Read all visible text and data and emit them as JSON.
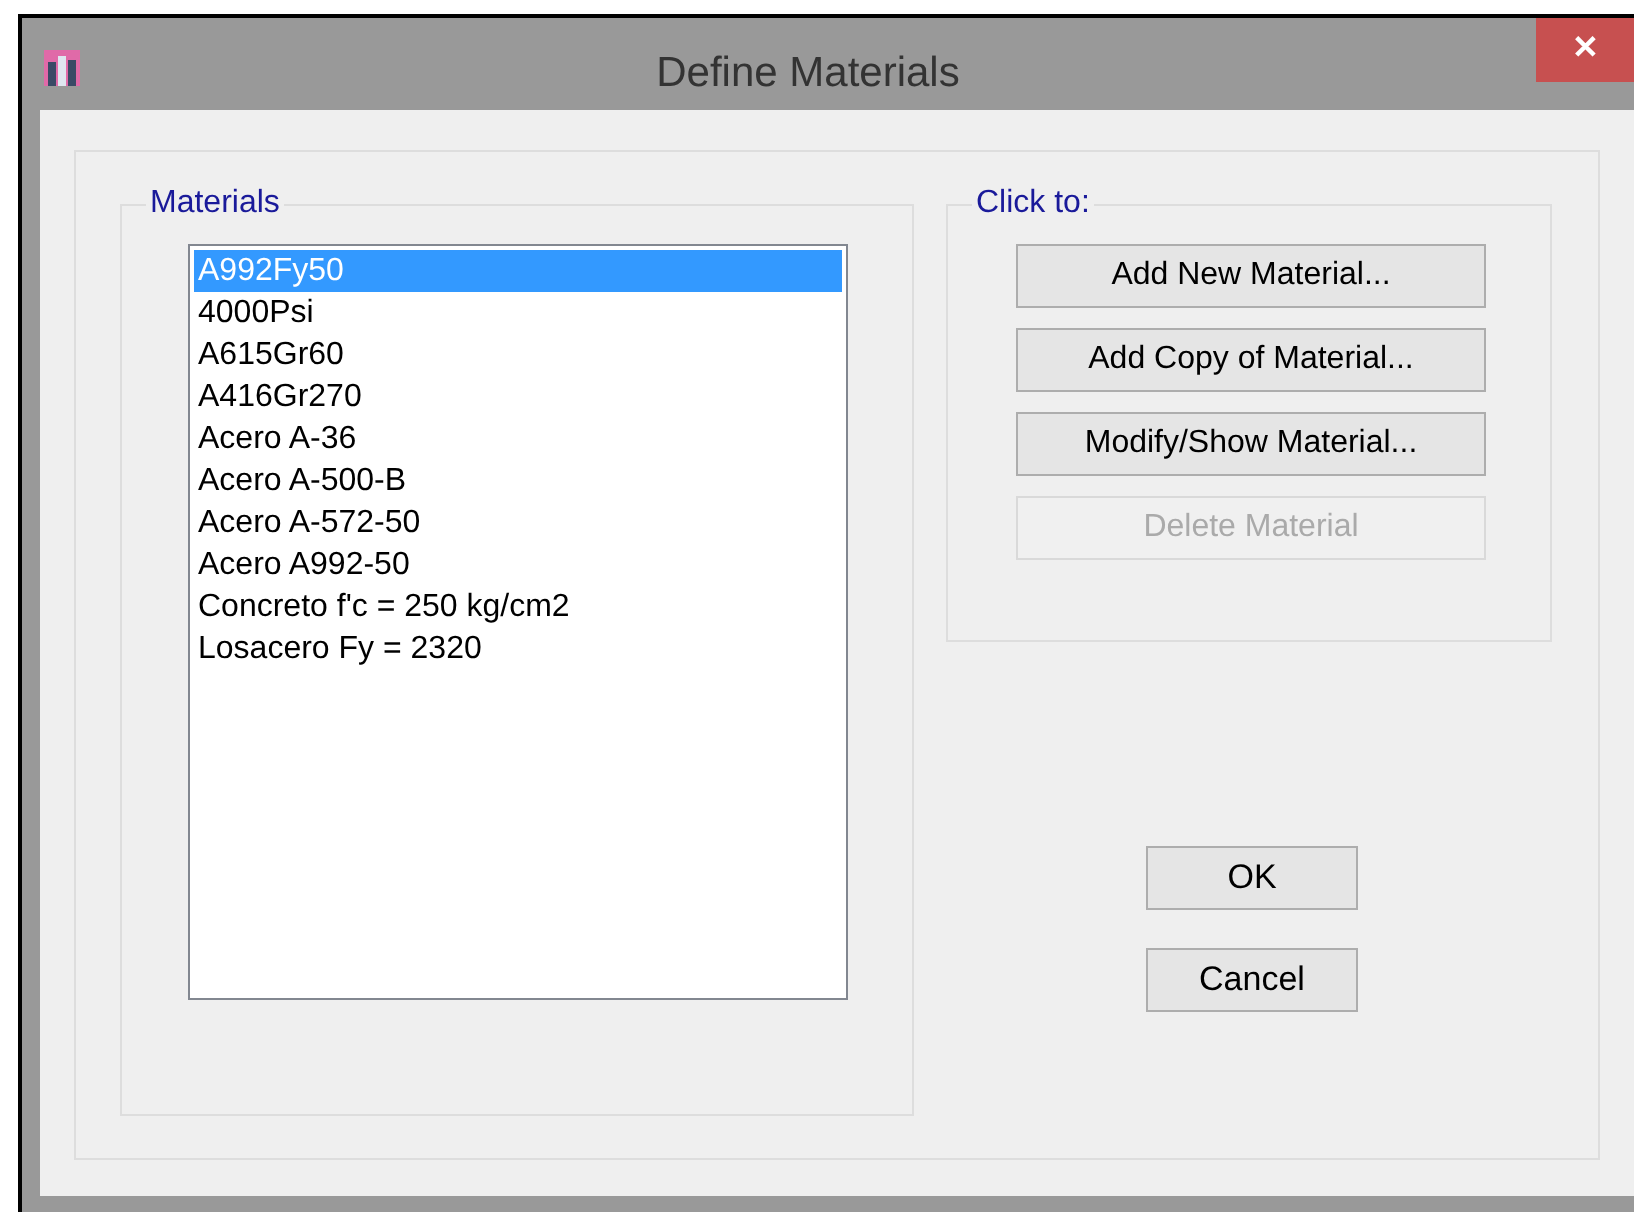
{
  "window": {
    "title": "Define Materials",
    "close": "✕"
  },
  "materials": {
    "label": "Materials",
    "items": [
      {
        "name": "A992Fy50",
        "selected": true
      },
      {
        "name": "4000Psi",
        "selected": false
      },
      {
        "name": "A615Gr60",
        "selected": false
      },
      {
        "name": "A416Gr270",
        "selected": false
      },
      {
        "name": "Acero A-36",
        "selected": false
      },
      {
        "name": "Acero A-500-B",
        "selected": false
      },
      {
        "name": "Acero A-572-50",
        "selected": false
      },
      {
        "name": "Acero A992-50",
        "selected": false
      },
      {
        "name": "Concreto f'c = 250 kg/cm2",
        "selected": false
      },
      {
        "name": "Losacero Fy = 2320",
        "selected": false
      }
    ]
  },
  "actions": {
    "label": "Click to:",
    "buttons": [
      {
        "label": "Add New Material...",
        "disabled": false
      },
      {
        "label": "Add Copy of Material...",
        "disabled": false
      },
      {
        "label": "Modify/Show Material...",
        "disabled": false
      },
      {
        "label": "Delete Material",
        "disabled": true
      }
    ]
  },
  "buttons": [
    "OK",
    "Cancel"
  ]
}
